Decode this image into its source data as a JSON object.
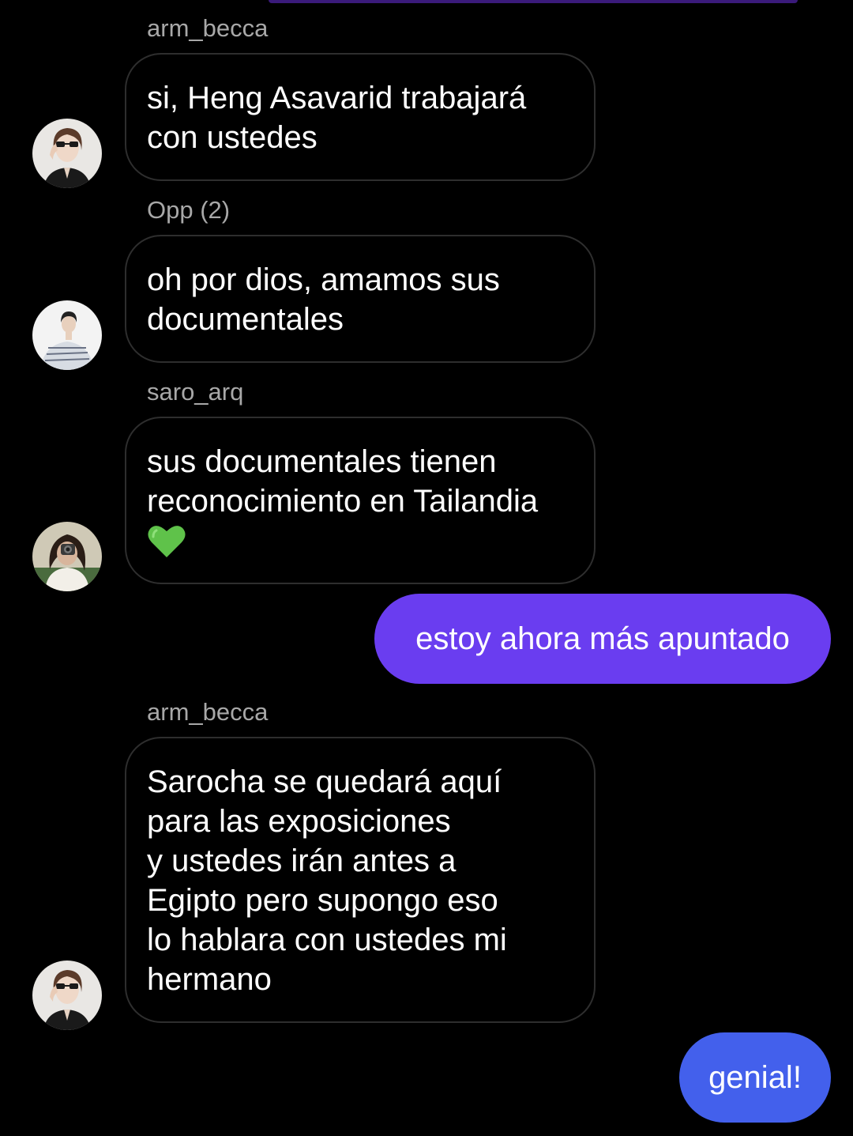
{
  "colors": {
    "background": "#000000",
    "incoming_border": "#2e2e2e",
    "sender_name": "#a8a8a8",
    "outgoing_bubble_1": "#6a3df0",
    "outgoing_bubble_2": "#4360ec",
    "heart": "#5fc24a"
  },
  "messages": [
    {
      "sender": "arm_becca",
      "lines": [
        "si, Heng Asavarid trabajará",
        "con ustedes"
      ]
    },
    {
      "sender": "Opp (2)",
      "lines": [
        "oh por dios, amamos sus",
        "documentales"
      ]
    },
    {
      "sender": "saro_arq",
      "lines": [
        "sus documentales tienen",
        "reconocimiento en Tailandia"
      ],
      "emoji": "green-heart-icon"
    },
    {
      "outgoing": true,
      "text": "estoy ahora más apuntado"
    },
    {
      "sender": "arm_becca",
      "lines": [
        "Sarocha se quedará aquí",
        "para las exposiciones",
        "y ustedes irán antes a",
        "Egipto pero supongo eso",
        "lo hablara con ustedes mi",
        "hermano"
      ]
    },
    {
      "outgoing": true,
      "text": "genial!"
    }
  ]
}
